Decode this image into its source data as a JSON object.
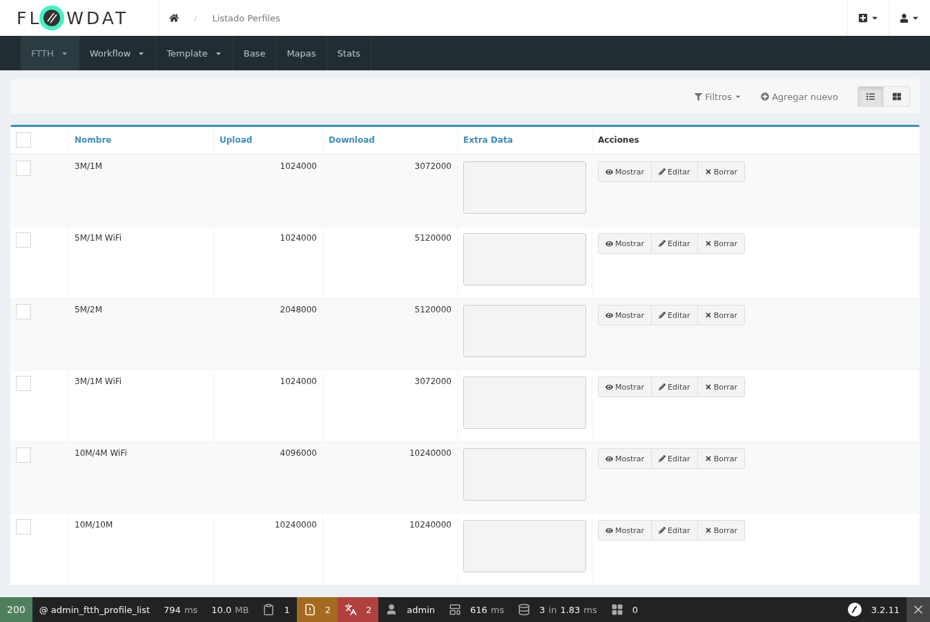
{
  "logo": {
    "left": "FL",
    "right": "WDAT"
  },
  "breadcrumb": {
    "separator": "/",
    "current": "Listado Perfiles"
  },
  "nav": [
    {
      "label": "FTTH",
      "dropdown": true,
      "selected": true
    },
    {
      "label": "Workflow",
      "dropdown": true,
      "selected": false
    },
    {
      "label": "Template",
      "dropdown": true,
      "selected": false
    },
    {
      "label": "Base",
      "dropdown": false,
      "selected": false
    },
    {
      "label": "Mapas",
      "dropdown": false,
      "selected": false
    },
    {
      "label": "Stats",
      "dropdown": false,
      "selected": false
    }
  ],
  "filter_bar": {
    "filters": "Filtros",
    "add": "Agregar nuevo",
    "views": [
      {
        "kind": "list",
        "selected": true
      },
      {
        "kind": "grid",
        "selected": false
      }
    ]
  },
  "table": {
    "select_all": {
      "checked": false
    },
    "columns": [
      {
        "label": "Nombre",
        "sortable": true
      },
      {
        "label": "Upload",
        "sortable": true
      },
      {
        "label": "Download",
        "sortable": true
      },
      {
        "label": "Extra Data",
        "sortable": true
      },
      {
        "label": "Acciones",
        "sortable": false
      }
    ],
    "rows": [
      {
        "name": "3M/1M",
        "upload": "1024000",
        "download": "3072000",
        "checked": false,
        "actions": [
          "Mostrar",
          "Editar",
          "Borrar"
        ]
      },
      {
        "name": "5M/1M WiFi",
        "upload": "1024000",
        "download": "5120000",
        "checked": false,
        "actions": [
          "Mostrar",
          "Editar",
          "Borrar"
        ]
      },
      {
        "name": "5M/2M",
        "upload": "2048000",
        "download": "5120000",
        "checked": false,
        "actions": [
          "Mostrar",
          "Editar",
          "Borrar"
        ]
      },
      {
        "name": "3M/1M WiFi",
        "upload": "1024000",
        "download": "3072000",
        "checked": false,
        "actions": [
          "Mostrar",
          "Editar",
          "Borrar"
        ]
      },
      {
        "name": "10M/4M WiFi",
        "upload": "4096000",
        "download": "10240000",
        "checked": false,
        "actions": [
          "Mostrar",
          "Editar",
          "Borrar"
        ]
      },
      {
        "name": "10M/10M",
        "upload": "10240000",
        "download": "10240000",
        "checked": false,
        "actions": [
          "Mostrar",
          "Editar",
          "Borrar"
        ]
      }
    ]
  },
  "debug_toolbar": {
    "status": "200",
    "route": "@ admin_ftth_profile_list",
    "time": "794",
    "time_unit": "ms",
    "memory": "10.0",
    "memory_unit": "MB",
    "items": [
      {
        "kind": "logs",
        "value": "1",
        "color": "#222222"
      },
      {
        "kind": "exceptions",
        "value": "2",
        "color": "#a46a1f"
      },
      {
        "kind": "translations",
        "value": "2",
        "color": "#b0413e"
      }
    ],
    "user": "admin",
    "render_time": "616",
    "render_unit": "ms",
    "db_count": "3",
    "db_in": "in",
    "db_time": "1.83",
    "db_unit": "ms",
    "forms": "0",
    "version": "3.2.11"
  }
}
